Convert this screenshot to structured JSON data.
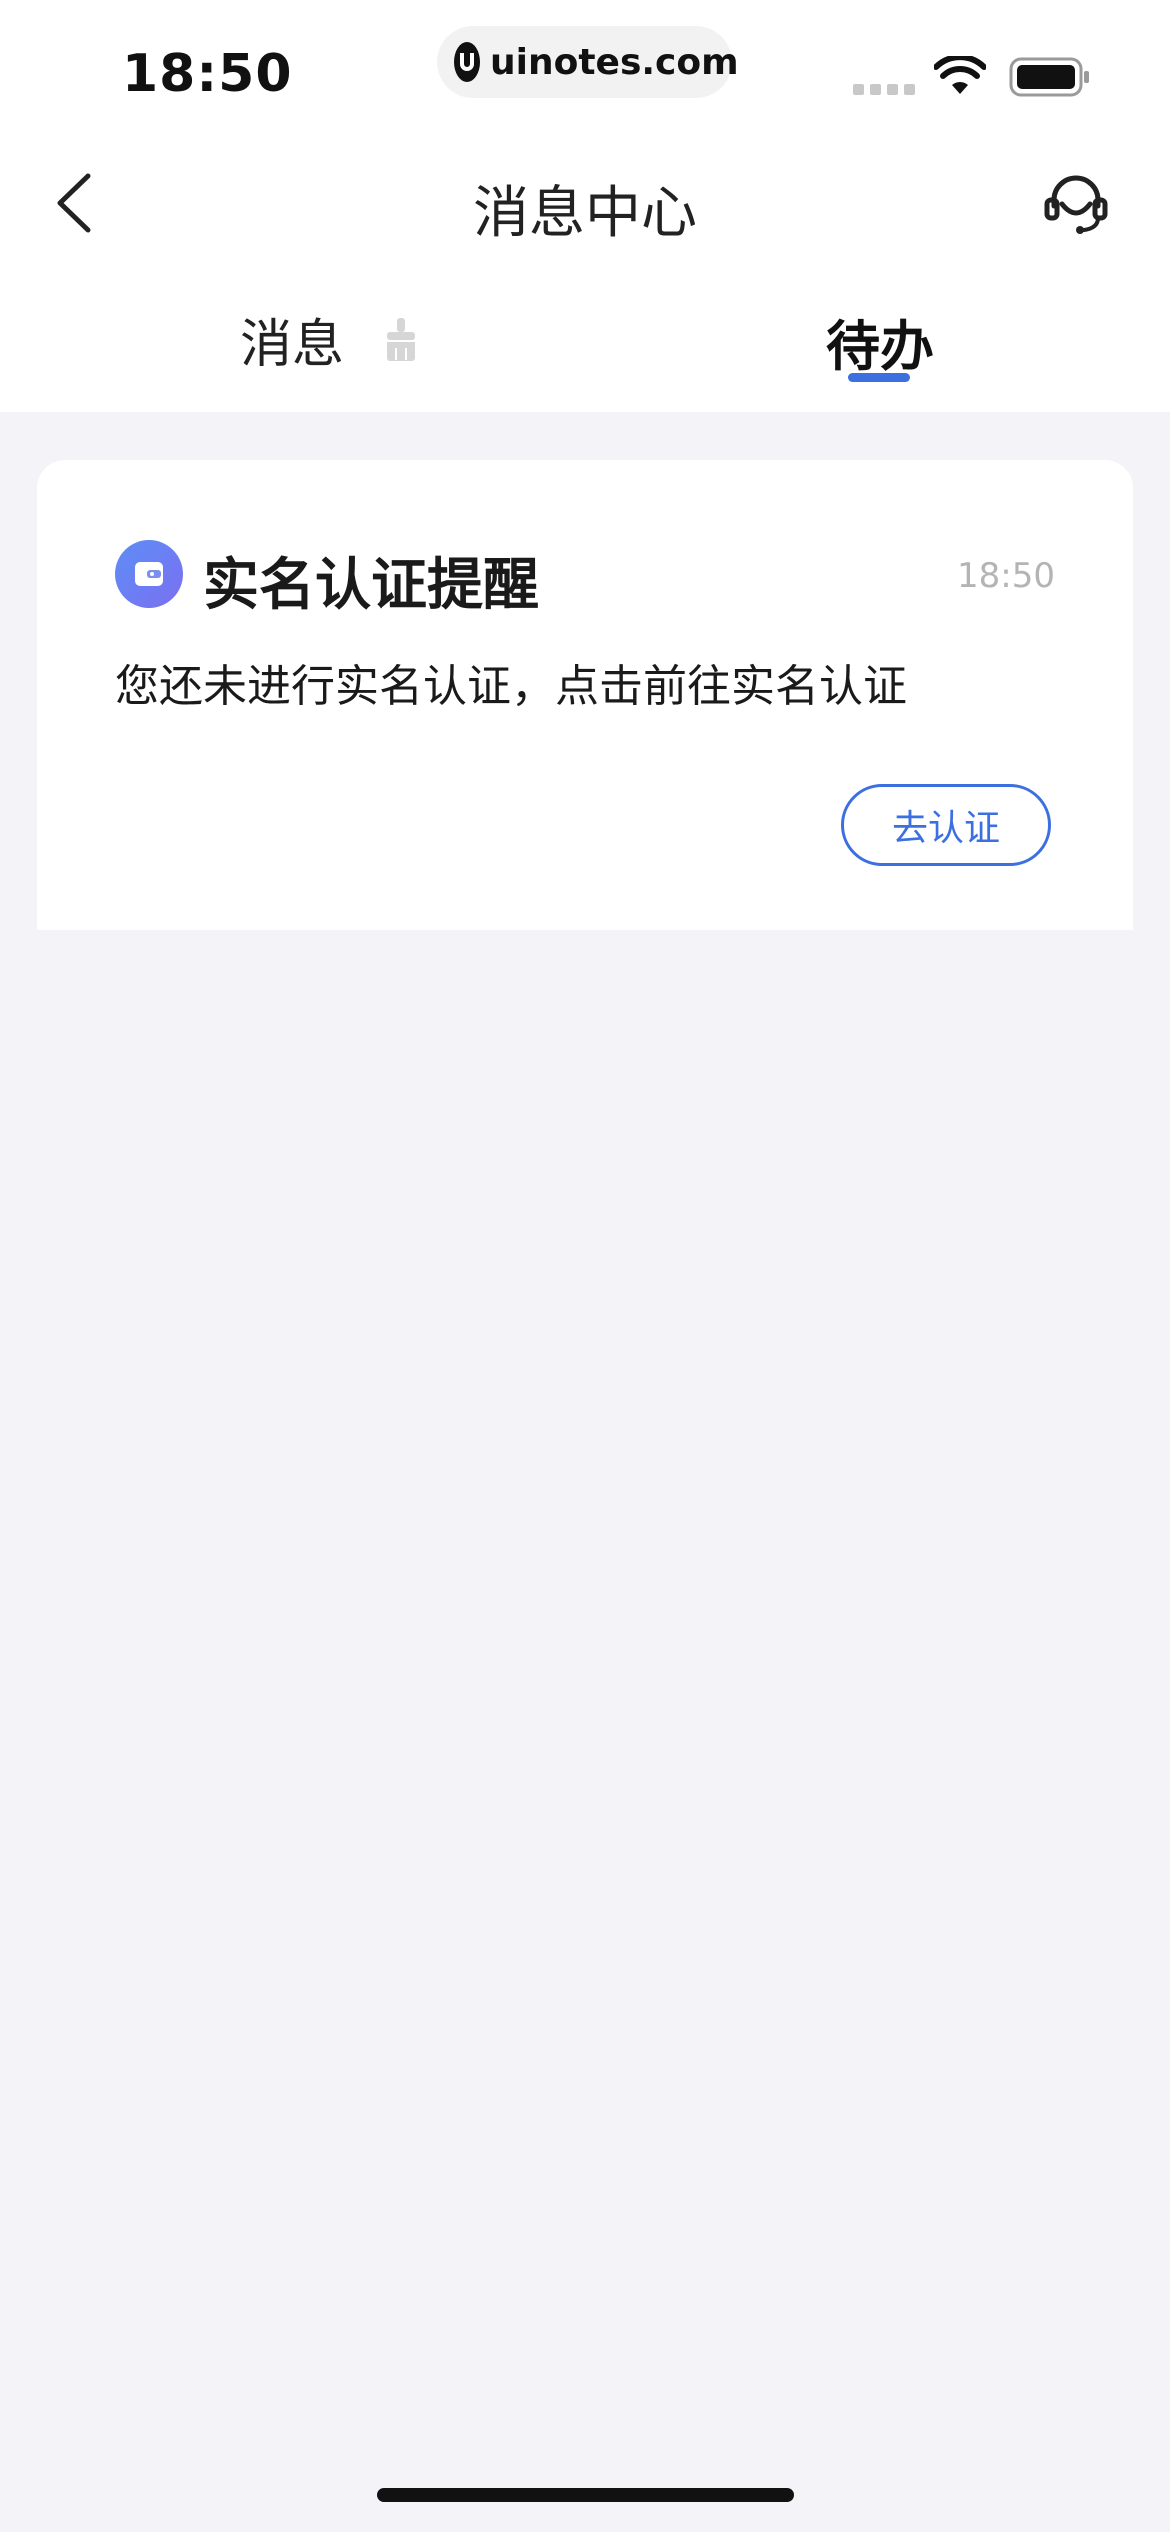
{
  "status_bar": {
    "time": "18:50",
    "url": "uinotes.com"
  },
  "nav": {
    "title": "消息中心",
    "back_icon": "chevron-left-icon",
    "service_icon": "headset-icon"
  },
  "tabs": [
    {
      "label": "消息",
      "active": false,
      "icon": "broom-icon"
    },
    {
      "label": "待办",
      "active": true
    }
  ],
  "todo_card": {
    "icon": "wallet-icon",
    "title": "实名认证提醒",
    "time": "18:50",
    "description": "您还未进行实名认证，点击前往实名认证",
    "action_label": "去认证"
  },
  "colors": {
    "accent": "#3c6fe0",
    "background": "#f3f3f8",
    "card": "#ffffff",
    "muted_text": "#b4b4b4"
  }
}
